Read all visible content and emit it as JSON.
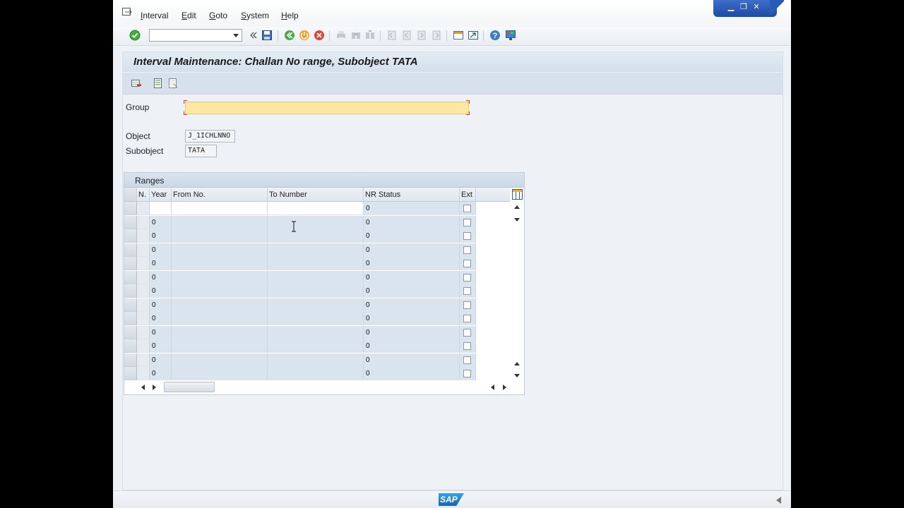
{
  "menu": {
    "items": [
      "Interval",
      "Edit",
      "Goto",
      "System",
      "Help"
    ]
  },
  "toolbar": {
    "command_field_value": ""
  },
  "page": {
    "title": "Interval Maintenance: Challan No range, Subobject TATA"
  },
  "form": {
    "group_label": "Group",
    "group_value": "",
    "object_label": "Object",
    "object_value": "J_1ICHLNNO",
    "subobject_label": "Subobject",
    "subobject_value": "TATA"
  },
  "ranges": {
    "title": "Ranges",
    "columns": [
      "N.",
      "Year",
      "From No.",
      "To Number",
      "NR Status",
      "Ext"
    ],
    "rows": [
      {
        "n": "",
        "year": "",
        "from": "",
        "to": "",
        "nr_status": "0",
        "ext": false
      },
      {
        "n": "",
        "year": "0",
        "from": "",
        "to": "",
        "nr_status": "0",
        "ext": false
      },
      {
        "n": "",
        "year": "0",
        "from": "",
        "to": "",
        "nr_status": "0",
        "ext": false
      },
      {
        "n": "",
        "year": "0",
        "from": "",
        "to": "",
        "nr_status": "0",
        "ext": false
      },
      {
        "n": "",
        "year": "0",
        "from": "",
        "to": "",
        "nr_status": "0",
        "ext": false
      },
      {
        "n": "",
        "year": "0",
        "from": "",
        "to": "",
        "nr_status": "0",
        "ext": false
      },
      {
        "n": "",
        "year": "0",
        "from": "",
        "to": "",
        "nr_status": "0",
        "ext": false
      },
      {
        "n": "",
        "year": "0",
        "from": "",
        "to": "",
        "nr_status": "0",
        "ext": false
      },
      {
        "n": "",
        "year": "0",
        "from": "",
        "to": "",
        "nr_status": "0",
        "ext": false
      },
      {
        "n": "",
        "year": "0",
        "from": "",
        "to": "",
        "nr_status": "0",
        "ext": false
      },
      {
        "n": "",
        "year": "0",
        "from": "",
        "to": "",
        "nr_status": "0",
        "ext": false
      },
      {
        "n": "",
        "year": "0",
        "from": "",
        "to": "",
        "nr_status": "0",
        "ext": false
      },
      {
        "n": "",
        "year": "0",
        "from": "",
        "to": "",
        "nr_status": "0",
        "ext": false
      }
    ]
  },
  "status": {
    "logo_text": "SAP"
  },
  "colors": {
    "required_field": "#fbe8a2",
    "title_bar": "#d3dfec",
    "window_controls": "#2a5bb8"
  }
}
